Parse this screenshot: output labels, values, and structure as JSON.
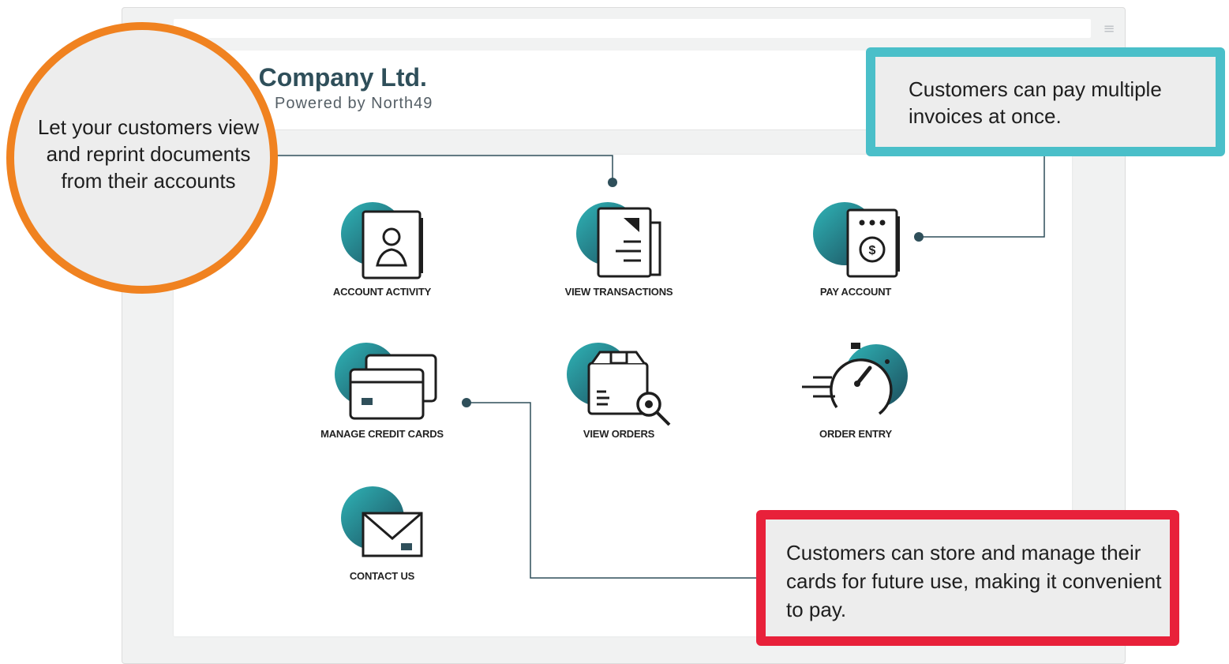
{
  "header": {
    "company_name": "le Company Ltd.",
    "powered_by": "Powered by North49",
    "menu_icon": "hamburger-icon"
  },
  "tiles": [
    {
      "label": "ACCOUNT ACTIVITY",
      "icon": "account-card-icon"
    },
    {
      "label": "VIEW TRANSACTIONS",
      "icon": "document-list-icon"
    },
    {
      "label": "PAY ACCOUNT",
      "icon": "payment-terminal-icon"
    },
    {
      "label": "MANAGE CREDIT CARDS",
      "icon": "credit-cards-icon"
    },
    {
      "label": "VIEW ORDERS",
      "icon": "package-search-icon"
    },
    {
      "label": "ORDER ENTRY",
      "icon": "stopwatch-speed-icon"
    },
    {
      "label": "CONTACT US",
      "icon": "envelope-icon"
    }
  ],
  "callouts": {
    "documents": "Let your customers view and reprint documents from their accounts",
    "invoices": "Customers can pay multiple invoices at once.",
    "cards": "Customers can store and manage their cards for future use, making it convenient to pay."
  },
  "colors": {
    "teal": "#2aa7ad",
    "dark": "#2f4f5a",
    "orange": "#f08220",
    "cyan_border": "#4abfc9",
    "red_border": "#e8213a"
  }
}
